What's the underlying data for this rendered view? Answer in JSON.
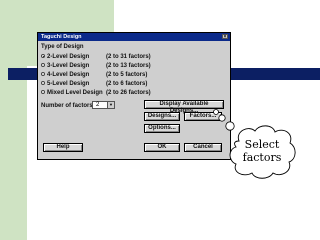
{
  "dialog": {
    "title": "Taguchi Design",
    "group_label": "Type of Design",
    "options": [
      {
        "label": "2-Level Design",
        "range": "(2 to 31 factors)",
        "selected": true
      },
      {
        "label": "3-Level Design",
        "range": "(2 to 13 factors)",
        "selected": false
      },
      {
        "label": "4-Level Design",
        "range": "(2 to 5 factors)",
        "selected": false
      },
      {
        "label": "5-Level Design",
        "range": "(2 to 6 factors)",
        "selected": false
      },
      {
        "label": "Mixed Level Design",
        "range": "(2 to 26 factors)",
        "selected": false
      }
    ],
    "num_factors_label": "Number of factors:",
    "num_factors_value": "2",
    "buttons": {
      "display": "Display Available Designs...",
      "designs": "Designs...",
      "factors": "Factors...",
      "options": "Options...",
      "help": "Help",
      "ok": "OK",
      "cancel": "Cancel"
    }
  },
  "callout": {
    "line1": "Select",
    "line2": "factors"
  },
  "colors": {
    "green": "#cfe3c3",
    "navy": "#0c1f63",
    "titlebar": "#0b2a8a",
    "dialog_bg": "#cfcfcf"
  }
}
